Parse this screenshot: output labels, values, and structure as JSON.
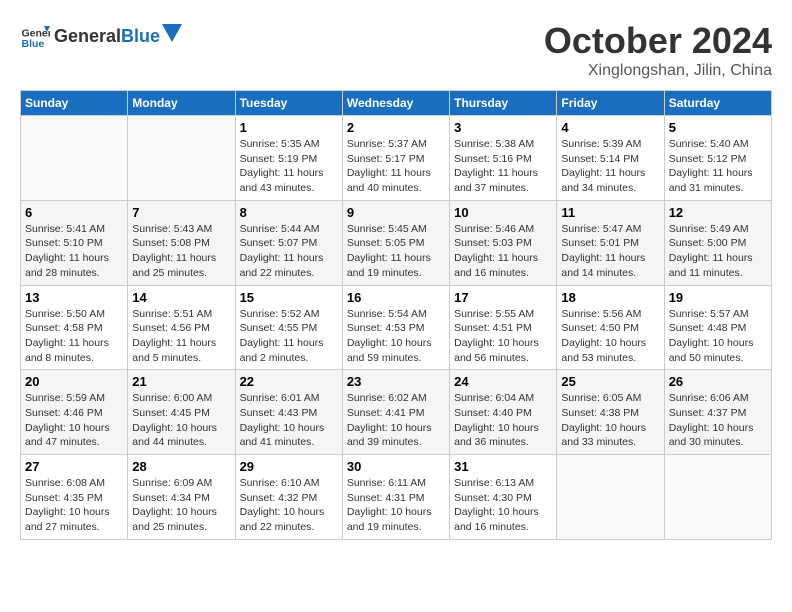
{
  "header": {
    "logo_general": "General",
    "logo_blue": "Blue",
    "month_title": "October 2024",
    "location": "Xinglongshan, Jilin, China"
  },
  "weekdays": [
    "Sunday",
    "Monday",
    "Tuesday",
    "Wednesday",
    "Thursday",
    "Friday",
    "Saturday"
  ],
  "weeks": [
    [
      {
        "day": "",
        "info": ""
      },
      {
        "day": "",
        "info": ""
      },
      {
        "day": "1",
        "info": "Sunrise: 5:35 AM\nSunset: 5:19 PM\nDaylight: 11 hours and 43 minutes."
      },
      {
        "day": "2",
        "info": "Sunrise: 5:37 AM\nSunset: 5:17 PM\nDaylight: 11 hours and 40 minutes."
      },
      {
        "day": "3",
        "info": "Sunrise: 5:38 AM\nSunset: 5:16 PM\nDaylight: 11 hours and 37 minutes."
      },
      {
        "day": "4",
        "info": "Sunrise: 5:39 AM\nSunset: 5:14 PM\nDaylight: 11 hours and 34 minutes."
      },
      {
        "day": "5",
        "info": "Sunrise: 5:40 AM\nSunset: 5:12 PM\nDaylight: 11 hours and 31 minutes."
      }
    ],
    [
      {
        "day": "6",
        "info": "Sunrise: 5:41 AM\nSunset: 5:10 PM\nDaylight: 11 hours and 28 minutes."
      },
      {
        "day": "7",
        "info": "Sunrise: 5:43 AM\nSunset: 5:08 PM\nDaylight: 11 hours and 25 minutes."
      },
      {
        "day": "8",
        "info": "Sunrise: 5:44 AM\nSunset: 5:07 PM\nDaylight: 11 hours and 22 minutes."
      },
      {
        "day": "9",
        "info": "Sunrise: 5:45 AM\nSunset: 5:05 PM\nDaylight: 11 hours and 19 minutes."
      },
      {
        "day": "10",
        "info": "Sunrise: 5:46 AM\nSunset: 5:03 PM\nDaylight: 11 hours and 16 minutes."
      },
      {
        "day": "11",
        "info": "Sunrise: 5:47 AM\nSunset: 5:01 PM\nDaylight: 11 hours and 14 minutes."
      },
      {
        "day": "12",
        "info": "Sunrise: 5:49 AM\nSunset: 5:00 PM\nDaylight: 11 hours and 11 minutes."
      }
    ],
    [
      {
        "day": "13",
        "info": "Sunrise: 5:50 AM\nSunset: 4:58 PM\nDaylight: 11 hours and 8 minutes."
      },
      {
        "day": "14",
        "info": "Sunrise: 5:51 AM\nSunset: 4:56 PM\nDaylight: 11 hours and 5 minutes."
      },
      {
        "day": "15",
        "info": "Sunrise: 5:52 AM\nSunset: 4:55 PM\nDaylight: 11 hours and 2 minutes."
      },
      {
        "day": "16",
        "info": "Sunrise: 5:54 AM\nSunset: 4:53 PM\nDaylight: 10 hours and 59 minutes."
      },
      {
        "day": "17",
        "info": "Sunrise: 5:55 AM\nSunset: 4:51 PM\nDaylight: 10 hours and 56 minutes."
      },
      {
        "day": "18",
        "info": "Sunrise: 5:56 AM\nSunset: 4:50 PM\nDaylight: 10 hours and 53 minutes."
      },
      {
        "day": "19",
        "info": "Sunrise: 5:57 AM\nSunset: 4:48 PM\nDaylight: 10 hours and 50 minutes."
      }
    ],
    [
      {
        "day": "20",
        "info": "Sunrise: 5:59 AM\nSunset: 4:46 PM\nDaylight: 10 hours and 47 minutes."
      },
      {
        "day": "21",
        "info": "Sunrise: 6:00 AM\nSunset: 4:45 PM\nDaylight: 10 hours and 44 minutes."
      },
      {
        "day": "22",
        "info": "Sunrise: 6:01 AM\nSunset: 4:43 PM\nDaylight: 10 hours and 41 minutes."
      },
      {
        "day": "23",
        "info": "Sunrise: 6:02 AM\nSunset: 4:41 PM\nDaylight: 10 hours and 39 minutes."
      },
      {
        "day": "24",
        "info": "Sunrise: 6:04 AM\nSunset: 4:40 PM\nDaylight: 10 hours and 36 minutes."
      },
      {
        "day": "25",
        "info": "Sunrise: 6:05 AM\nSunset: 4:38 PM\nDaylight: 10 hours and 33 minutes."
      },
      {
        "day": "26",
        "info": "Sunrise: 6:06 AM\nSunset: 4:37 PM\nDaylight: 10 hours and 30 minutes."
      }
    ],
    [
      {
        "day": "27",
        "info": "Sunrise: 6:08 AM\nSunset: 4:35 PM\nDaylight: 10 hours and 27 minutes."
      },
      {
        "day": "28",
        "info": "Sunrise: 6:09 AM\nSunset: 4:34 PM\nDaylight: 10 hours and 25 minutes."
      },
      {
        "day": "29",
        "info": "Sunrise: 6:10 AM\nSunset: 4:32 PM\nDaylight: 10 hours and 22 minutes."
      },
      {
        "day": "30",
        "info": "Sunrise: 6:11 AM\nSunset: 4:31 PM\nDaylight: 10 hours and 19 minutes."
      },
      {
        "day": "31",
        "info": "Sunrise: 6:13 AM\nSunset: 4:30 PM\nDaylight: 10 hours and 16 minutes."
      },
      {
        "day": "",
        "info": ""
      },
      {
        "day": "",
        "info": ""
      }
    ]
  ]
}
